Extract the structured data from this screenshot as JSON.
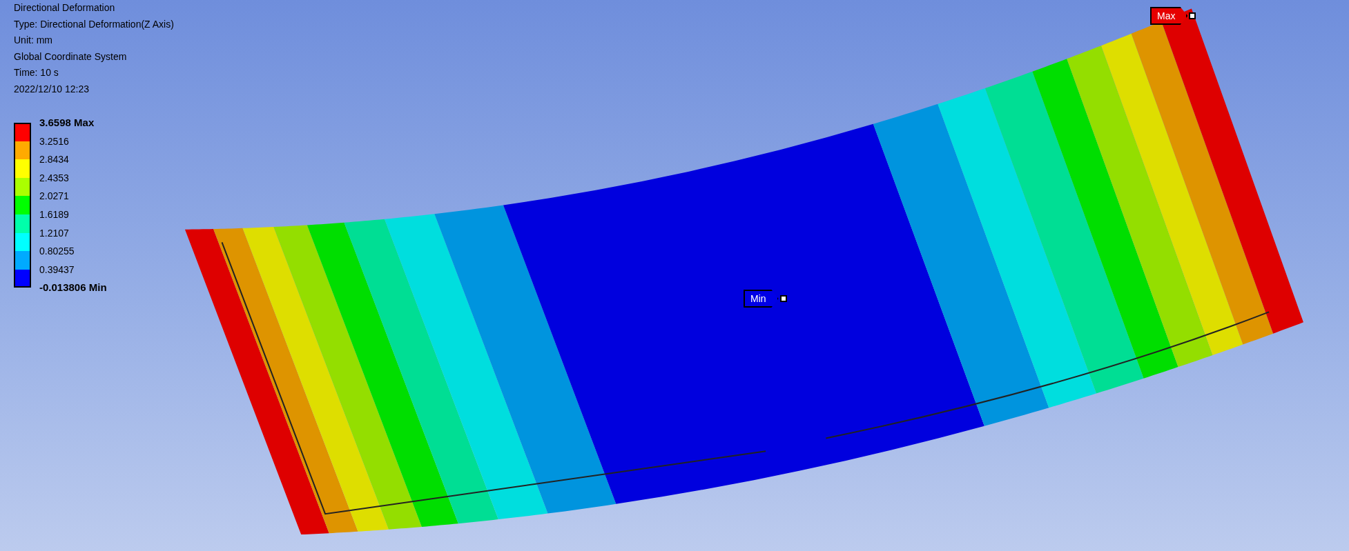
{
  "header": {
    "lines": [
      "Directional Deformation",
      "Type: Directional Deformation(Z Axis)",
      "Unit: mm",
      "Global Coordinate System",
      "Time: 10 s",
      "2022/12/10 12:23"
    ]
  },
  "legend": {
    "bands": [
      {
        "color": "#ff0000"
      },
      {
        "color": "#ffaa00"
      },
      {
        "color": "#ffff00"
      },
      {
        "color": "#aaff00"
      },
      {
        "color": "#00ff00"
      },
      {
        "color": "#00ffaa"
      },
      {
        "color": "#00ffff"
      },
      {
        "color": "#00aaff"
      },
      {
        "color": "#0000ff"
      }
    ],
    "labels": [
      {
        "text": "3.6598 Max",
        "kind": "max"
      },
      {
        "text": "3.2516",
        "kind": "value"
      },
      {
        "text": "2.8434",
        "kind": "value"
      },
      {
        "text": "2.4353",
        "kind": "value"
      },
      {
        "text": "2.0271",
        "kind": "value"
      },
      {
        "text": "1.6189",
        "kind": "value"
      },
      {
        "text": "1.2107",
        "kind": "value"
      },
      {
        "text": "0.80255",
        "kind": "value"
      },
      {
        "text": "0.39437",
        "kind": "value"
      },
      {
        "text": "-0.013806 Min",
        "kind": "min"
      }
    ]
  },
  "probes": [
    {
      "label": "Max",
      "kind": "max"
    },
    {
      "label": "Min",
      "kind": "min"
    }
  ]
}
